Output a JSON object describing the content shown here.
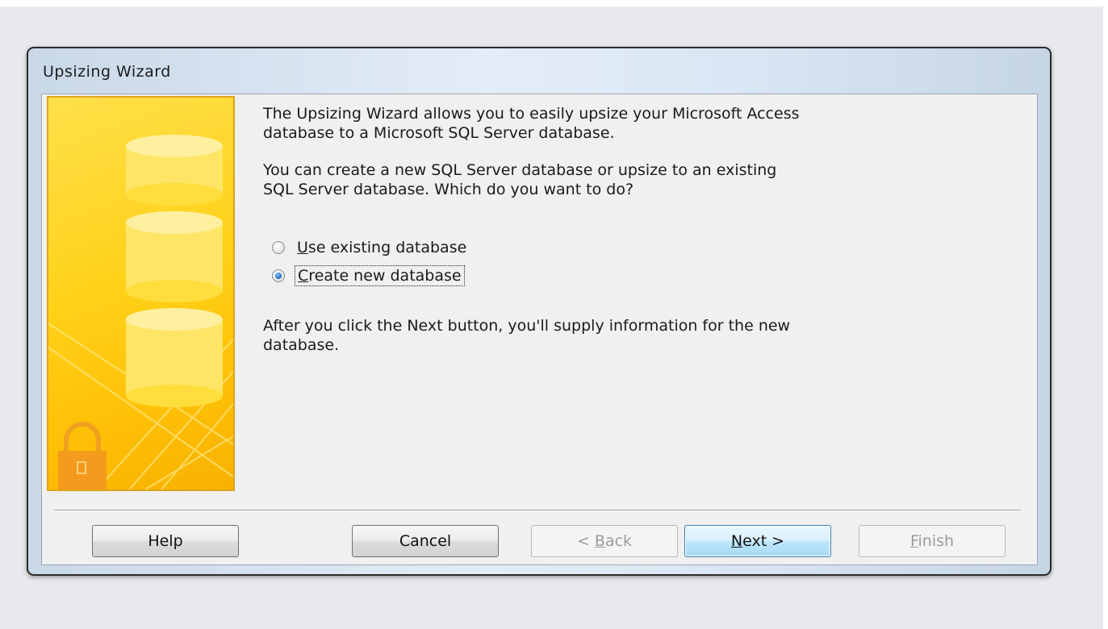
{
  "window": {
    "title": "Upsizing  Wizard"
  },
  "intro": {
    "paragraph1_line1": "The Upsizing Wizard allows you to easily upsize your Microsoft Access",
    "paragraph1_line2": "database to a Microsoft SQL Server database.",
    "paragraph2_line1": "You can create a new SQL Server database or upsize to an existing",
    "paragraph2_line2": "SQL Server database. Which do you want to do?"
  },
  "options": [
    {
      "mnemonic": "U",
      "label_rest": "se existing database",
      "selected": false
    },
    {
      "mnemonic": "C",
      "label_rest": "reate new database",
      "selected": true
    }
  ],
  "after": {
    "line1": "After you click the Next button, you'll supply information for the new",
    "line2": "database."
  },
  "buttons": {
    "help": "Help",
    "cancel": "Cancel",
    "back_prefix": "< ",
    "back_mnemonic": "B",
    "back_rest": "ack",
    "next_mnemonic": "N",
    "next_rest": "ext >",
    "finish_mnemonic": "F",
    "finish_rest": "inish"
  },
  "colors": {
    "panel_yellow": "#ffd21a",
    "panel_border": "#e0a21d",
    "lock_orange": "#f59a1c",
    "radio_selected": "#1c64b7",
    "default_button_border": "#3c7fb1"
  },
  "icons": {
    "side_art": "database-cylinders-icon",
    "lock": "padlock-icon"
  }
}
